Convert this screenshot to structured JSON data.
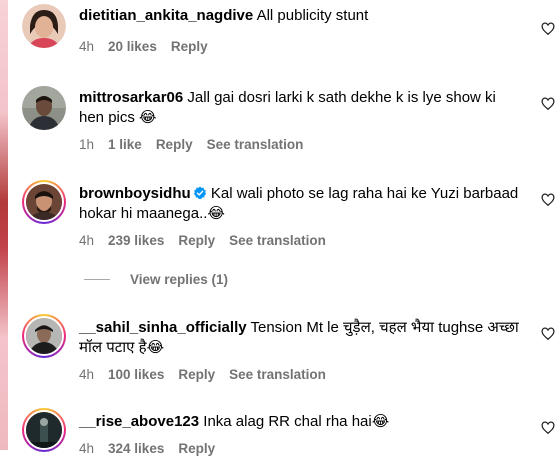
{
  "comments": [
    {
      "username": "dietitian_ankita_nagdive",
      "text": "All publicity stunt",
      "time": "4h",
      "likes": "20 likes",
      "reply": "Reply",
      "translation": ""
    },
    {
      "username": "mittrosarkar06",
      "text": "Jall gai dosri larki k sath dekhe k is lye show ki hen pics 😂",
      "time": "1h",
      "likes": "1 like",
      "reply": "Reply",
      "translation": "See translation"
    },
    {
      "username": "brownboysidhu",
      "text": "Kal wali photo se lag raha hai ke Yuzi barbaad hokar hi maanega..😂",
      "time": "4h",
      "likes": "239 likes",
      "reply": "Reply",
      "translation": "See translation",
      "verified": true
    },
    {
      "username": "__sahil_sinha_officially",
      "text": "Tension Mt le चुड़ैल, चहल भैया tughse अच्छा मॉल पटाए है😂",
      "time": "4h",
      "likes": "100 likes",
      "reply": "Reply",
      "translation": "See translation"
    },
    {
      "username": "__rise_above123",
      "text": "Inka alag RR chal rha hai😂",
      "time": "4h",
      "likes": "324 likes",
      "reply": "Reply",
      "translation": ""
    }
  ],
  "view_replies": "View replies (1)",
  "colors": {
    "meta_gray": "#737373",
    "verified_blue": "#0095f6"
  }
}
